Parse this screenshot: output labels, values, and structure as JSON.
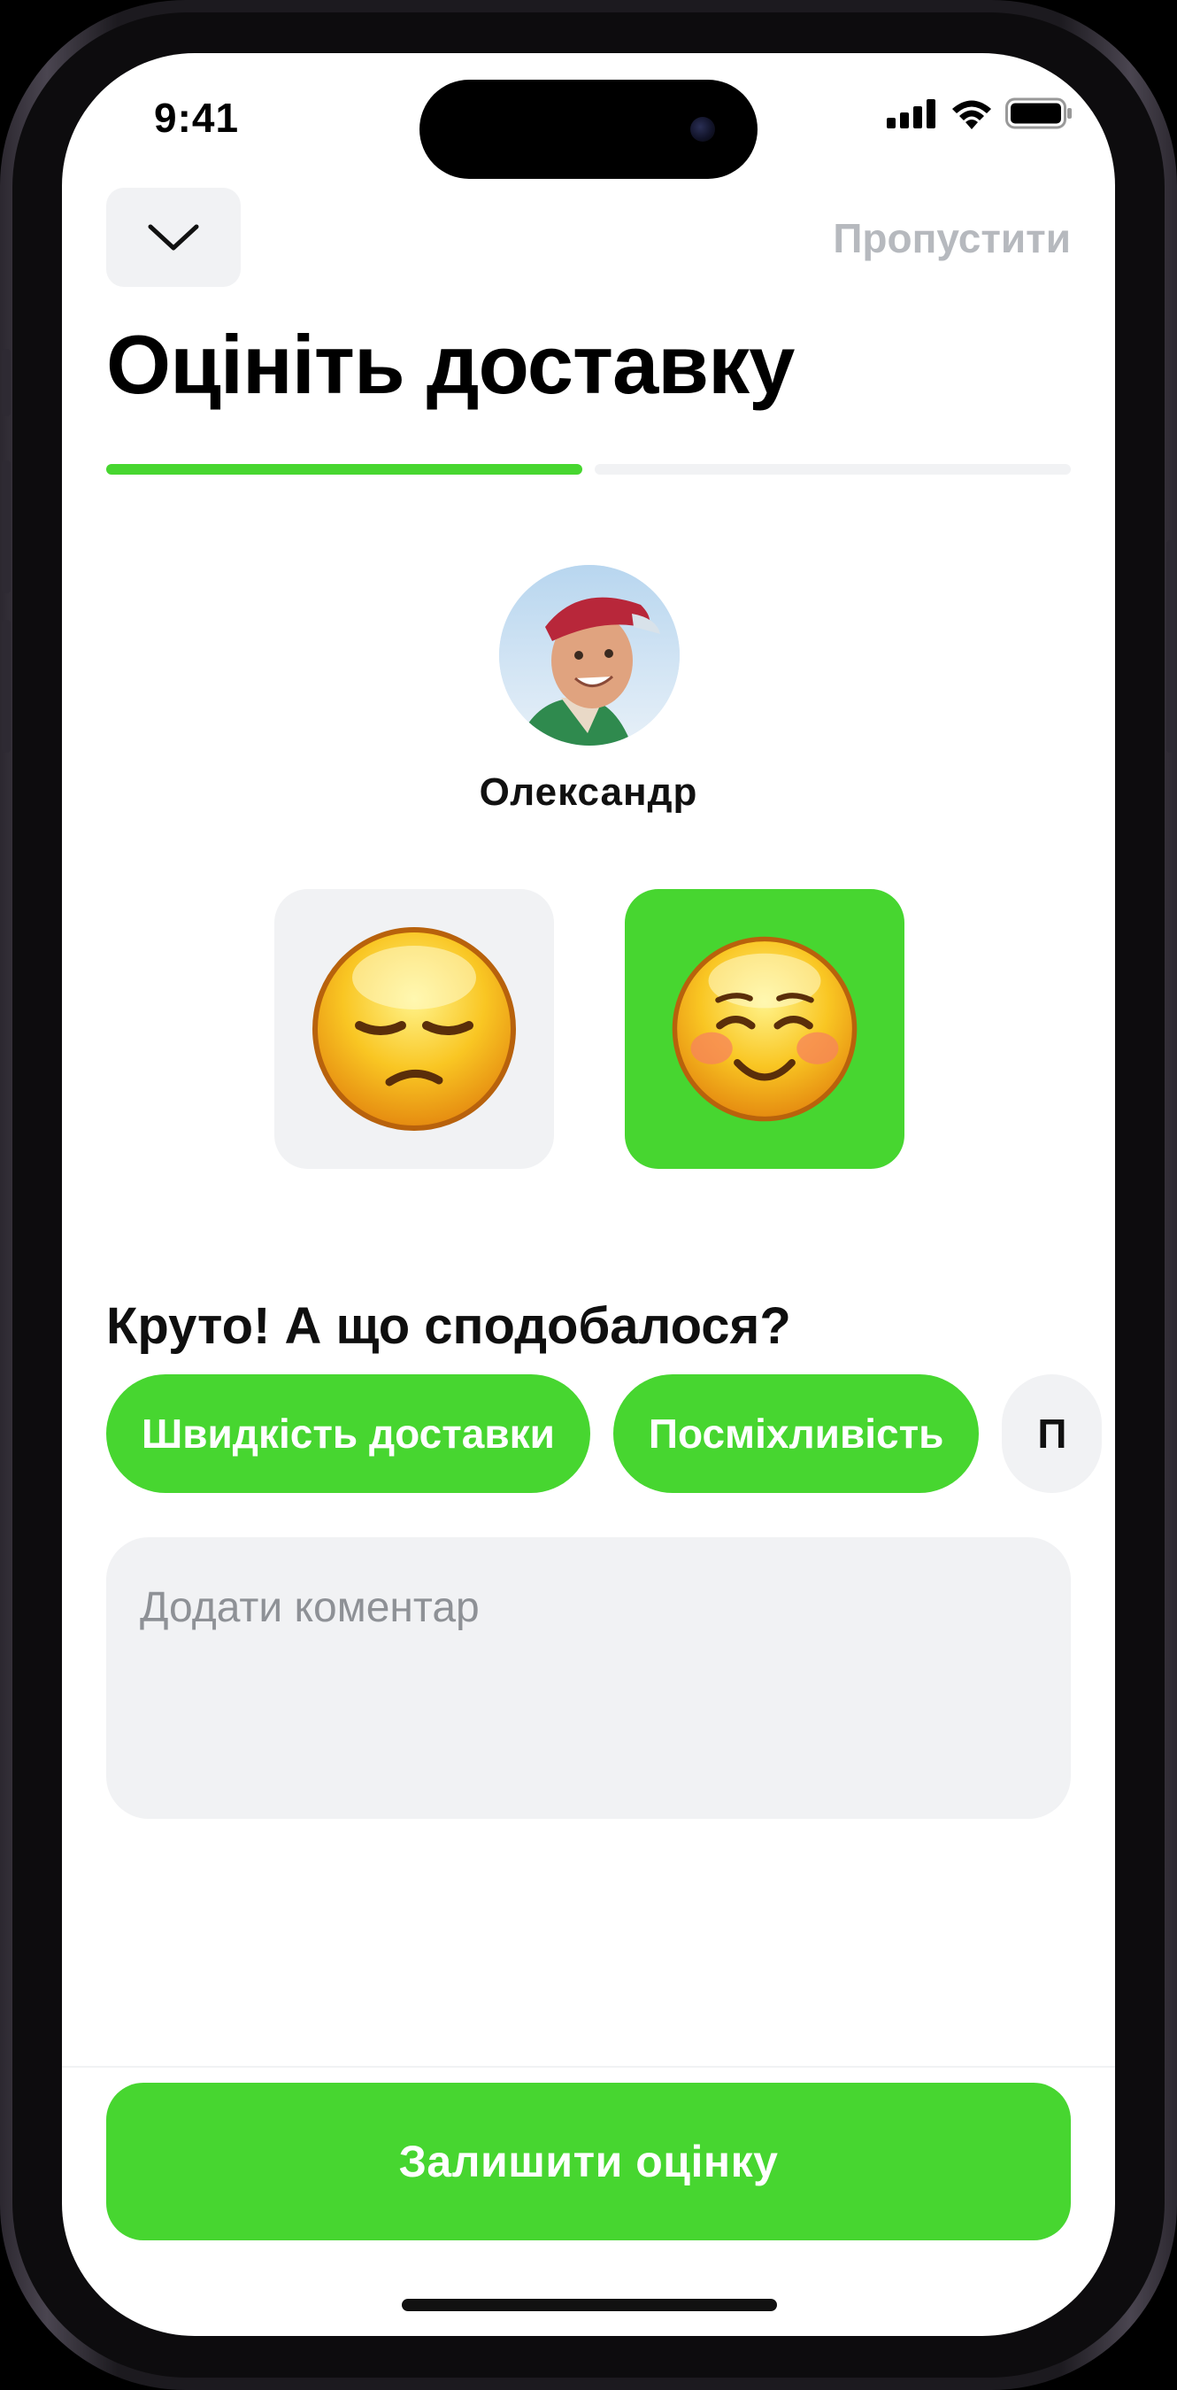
{
  "status_bar": {
    "time": "9:41",
    "signal_icon": "cellular-signal-icon",
    "wifi_icon": "wifi-icon",
    "battery_icon": "battery-icon"
  },
  "header": {
    "collapse_icon": "chevron-down-icon",
    "skip_label": "Пропустити",
    "title": "Оцініть доставку"
  },
  "progress": {
    "steps_total": 2,
    "step_current": 1
  },
  "courier": {
    "name": "Олександр",
    "avatar_icon": "courier-avatar"
  },
  "rating": {
    "options": [
      {
        "id": "bad",
        "icon": "unamused-face-icon",
        "selected": false
      },
      {
        "id": "good",
        "icon": "smiling-face-icon",
        "selected": true
      }
    ]
  },
  "feedback": {
    "question": "Круто! А що сподобалося?",
    "chips": [
      {
        "label": "Швидкість доставки",
        "selected": true
      },
      {
        "label": "Посміхливість",
        "selected": true
      },
      {
        "label": "П",
        "selected": false
      }
    ],
    "comment_placeholder": "Додати коментар",
    "comment_value": ""
  },
  "submit": {
    "label": "Залишити оцінку"
  },
  "colors": {
    "accent": "#47d630",
    "surface": "#f1f2f4",
    "muted_text": "#b6b9be",
    "placeholder": "#8e9196"
  }
}
